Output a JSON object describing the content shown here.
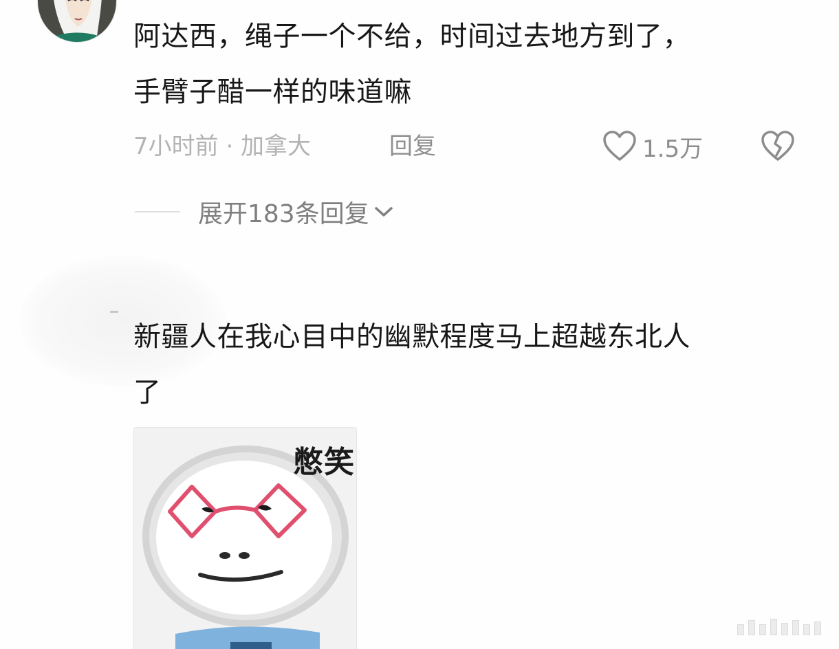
{
  "comment1": {
    "text": "阿达西，绳子一个不给，时间过去地方到了，\n手臂子醋一样的味道嘛",
    "time_location": "7小时前 · 加拿大",
    "reply_label": "回复",
    "like_count": "1.5万",
    "expand_label": "展开183条回复"
  },
  "comment2": {
    "text": "新疆人在我心目中的幽默程度马上超越东北人\n了",
    "sticker_caption": "憋笑"
  },
  "colors": {
    "text": "#171717",
    "meta": "#b3b3b3",
    "secondary": "#8f8f8f",
    "glasses": "#e0506e"
  },
  "icons": {
    "like": "heart-outline-icon",
    "dislike": "broken-heart-icon",
    "expand": "chevron-down-icon"
  }
}
